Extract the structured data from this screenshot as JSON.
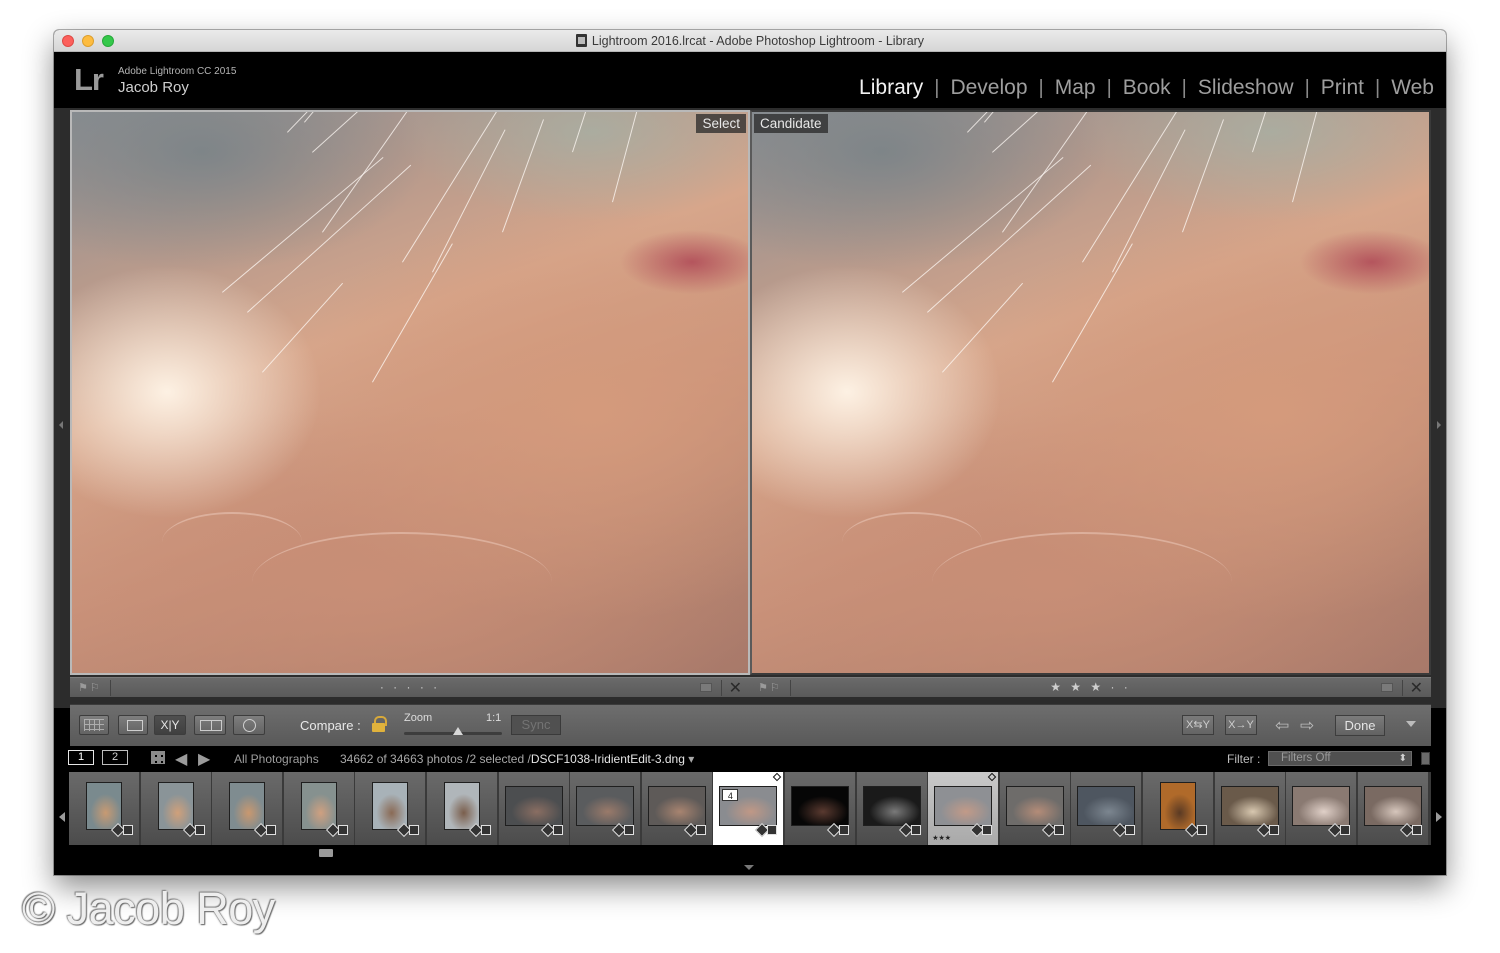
{
  "window": {
    "title": "Lightroom 2016.lrcat - Adobe Photoshop Lightroom - Library"
  },
  "identity": {
    "logo": "Lr",
    "product": "Adobe Lightroom CC 2015",
    "user": "Jacob Roy"
  },
  "modules": [
    {
      "label": "Library",
      "active": true
    },
    {
      "label": "Develop",
      "active": false
    },
    {
      "label": "Map",
      "active": false
    },
    {
      "label": "Book",
      "active": false
    },
    {
      "label": "Slideshow",
      "active": false
    },
    {
      "label": "Print",
      "active": false
    },
    {
      "label": "Web",
      "active": false
    }
  ],
  "module_separator": "|",
  "compare": {
    "select_label": "Select",
    "candidate_label": "Candidate",
    "select_rating": "· · · · ·",
    "candidate_rating": "★ ★ ★ · ·",
    "close_glyph": "✕"
  },
  "toolbar": {
    "xy_label": "X|Y",
    "compare_label": "Compare :",
    "zoom_label": "Zoom",
    "zoom_ratio": "1:1",
    "zoom_level": 0.55,
    "sync_label": "Sync",
    "swap_label": "X⇆Y",
    "make_select_label": "X→Y",
    "prev_arrow": "⇦",
    "next_arrow": "⇨",
    "done_label": "Done"
  },
  "filmbar": {
    "screen1": "1",
    "screen2": "2",
    "back_arrow": "◀",
    "forward_arrow": "▶",
    "source": "All Photographs",
    "count_text": "34662 of 34663 photos /2 selected /",
    "filename": "DSCF1038-IridientEdit-3.dng",
    "filename_caret": " ▾",
    "filter_label": "Filter :",
    "filter_value": "Filters Off"
  },
  "filmstrip": {
    "thumbnails": [
      {
        "color": "#7a8a8e",
        "tone": "#c89a72",
        "orientation": "portrait",
        "state": "normal"
      },
      {
        "color": "#8a9498",
        "tone": "#d0a07a",
        "orientation": "portrait",
        "state": "normal"
      },
      {
        "color": "#7f8c90",
        "tone": "#c9986f",
        "orientation": "portrait",
        "state": "normal"
      },
      {
        "color": "#86918f",
        "tone": "#cfa080",
        "orientation": "portrait",
        "state": "normal"
      },
      {
        "color": "#a8b2b8",
        "tone": "#8a6a55",
        "orientation": "portrait",
        "state": "normal"
      },
      {
        "color": "#b0b6ba",
        "tone": "#7a5e4c",
        "orientation": "portrait",
        "state": "normal"
      },
      {
        "color": "#4c4e50",
        "tone": "#8a6e62",
        "orientation": "landscape",
        "state": "normal"
      },
      {
        "color": "#5a5c5e",
        "tone": "#9a7a6a",
        "orientation": "landscape",
        "state": "normal"
      },
      {
        "color": "#5e5a58",
        "tone": "#a88470",
        "orientation": "landscape",
        "state": "normal"
      },
      {
        "color": "#8a8c90",
        "tone": "#c09886",
        "orientation": "landscape",
        "state": "selected-active",
        "index": "4"
      },
      {
        "color": "#060606",
        "tone": "#5a3a30",
        "orientation": "landscape",
        "state": "normal"
      },
      {
        "color": "#1a1a1a",
        "tone": "#7a7a7a",
        "orientation": "landscape",
        "state": "normal"
      },
      {
        "color": "#8e9094",
        "tone": "#c29a88",
        "orientation": "landscape",
        "state": "selected",
        "stars": "★★★"
      },
      {
        "color": "#6e6c6a",
        "tone": "#b48c78",
        "orientation": "landscape",
        "state": "normal"
      },
      {
        "color": "#4e5660",
        "tone": "#7c8690",
        "orientation": "landscape",
        "state": "normal"
      },
      {
        "color": "#b06a2a",
        "tone": "#5a3a24",
        "orientation": "portrait",
        "state": "normal"
      },
      {
        "color": "#6a5a4a",
        "tone": "#d8c8b0",
        "orientation": "landscape",
        "state": "normal"
      },
      {
        "color": "#8a7a72",
        "tone": "#e0d0c8",
        "orientation": "landscape",
        "state": "normal"
      },
      {
        "color": "#7a6a62",
        "tone": "#d6c6bc",
        "orientation": "landscape",
        "state": "normal"
      }
    ]
  },
  "watermark": "© Jacob Roy"
}
